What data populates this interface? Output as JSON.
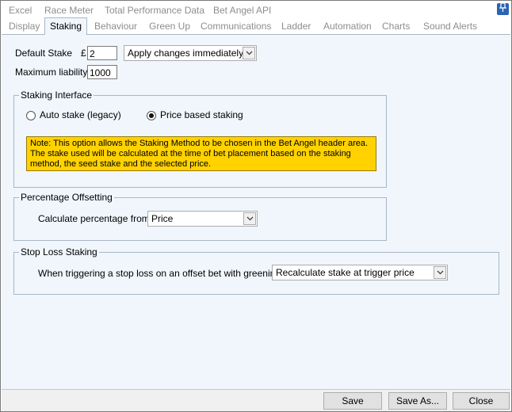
{
  "tabs_row1": [
    "Excel",
    "Race Meter",
    "Total Performance Data",
    "Bet Angel API"
  ],
  "tabs_row2": [
    "Display",
    "Staking",
    "Behaviour",
    "Green Up",
    "Communications",
    "Ladder",
    "Automation",
    "Charts",
    "Sound Alerts"
  ],
  "active_tab": "Staking",
  "pin_icon": "pin-icon",
  "staking": {
    "default_stake_label": "Default Stake",
    "currency_symbol": "£",
    "default_stake_value": "2",
    "apply_mode": "Apply changes immediately",
    "max_liability_label": "Maximum liability",
    "max_liability_value": "1000"
  },
  "staking_interface": {
    "title": "Staking Interface",
    "auto_label": "Auto stake (legacy)",
    "price_label": "Price based staking",
    "selected": "price",
    "note": "Note: This option allows the Staking Method to be chosen in the Bet Angel header area.  The stake used will be calculated at the time of bet placement based on the staking method, the seed stake and the selected price.",
    "note_color": "#ffd200"
  },
  "percentage_offsetting": {
    "title": "Percentage Offsetting",
    "calc_label": "Calculate percentage from",
    "calc_value": "Price"
  },
  "stop_loss": {
    "title": "Stop Loss Staking",
    "trigger_label": "When triggering a stop loss on an offset bet with greening",
    "trigger_value": "Recalculate stake at trigger price"
  },
  "buttons": {
    "save": "Save",
    "save_as": "Save As...",
    "close": "Close"
  }
}
